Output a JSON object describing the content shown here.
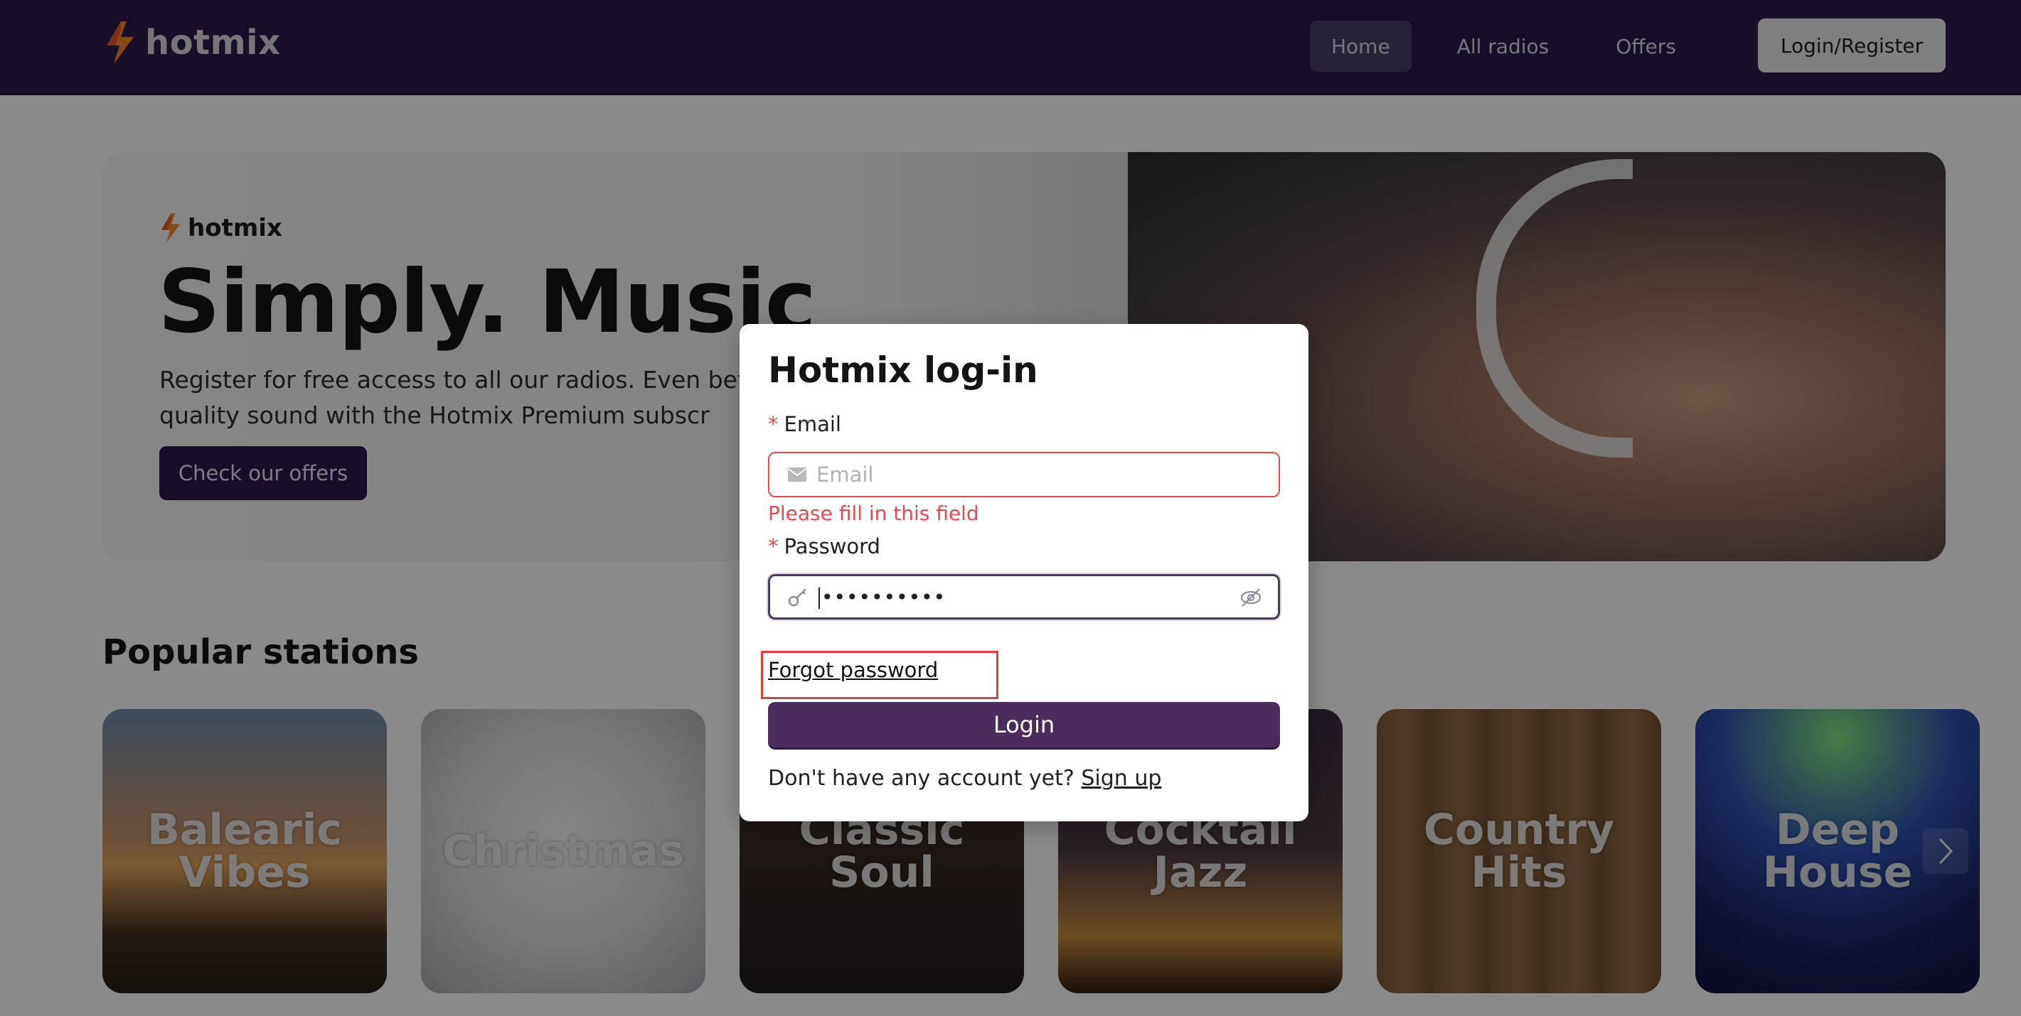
{
  "header": {
    "brand": "hotmix",
    "nav": [
      {
        "label": "Home",
        "active": true
      },
      {
        "label": "All radios",
        "active": false
      },
      {
        "label": "Offers",
        "active": false
      }
    ],
    "login_register_label": "Login/Register"
  },
  "hero": {
    "brand": "hotmix",
    "title": "Simply. Music",
    "text": "Register for free access to all our radios. Even better high quality sound with the Hotmix Premium subscr",
    "cta_label": "Check our offers"
  },
  "popular": {
    "title": "Popular stations",
    "stations": [
      {
        "label": "Balearic\nVibes"
      },
      {
        "label": "Christmas"
      },
      {
        "label": "Classic\nSoul"
      },
      {
        "label": "Cocktail\nJazz"
      },
      {
        "label": "Country\nHits"
      },
      {
        "label": "Deep\nHouse"
      }
    ]
  },
  "modal": {
    "title": "Hotmix log-in",
    "required_mark": "*",
    "email_label": "Email",
    "email_placeholder": "Email",
    "email_error": "Please fill in this field",
    "password_label": "Password",
    "password_masked": "••••••••••",
    "forgot_label": "Forgot password",
    "login_label": "Login",
    "signup_prompt": "Don't have any account yet? ",
    "signup_link": "Sign up"
  },
  "colors": {
    "brand_purple": "#2e1a47",
    "button_purple": "#4a2d5e",
    "error_red": "#e5484d",
    "highlight_red": "#e03c3c",
    "logo_orange": "#f08a24"
  }
}
